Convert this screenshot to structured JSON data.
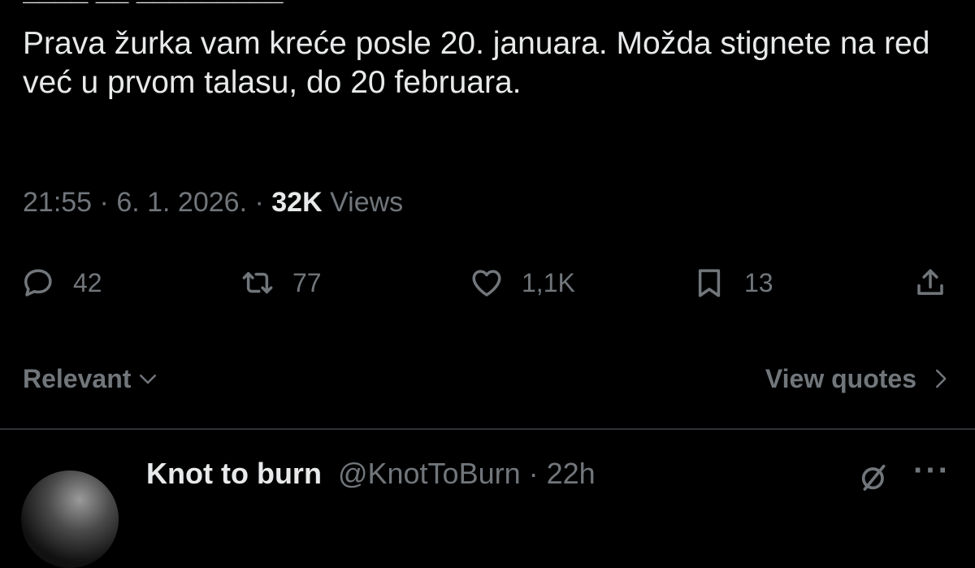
{
  "tweet": {
    "text": "Prava žurka vam kreće posle 20. januara. Možda stignete na red već u prvom talasu, do 20 februara.",
    "time": "21:55",
    "date": "6. 1. 2026.",
    "views_count": "32K",
    "views_label": "Views"
  },
  "actions": {
    "reply_count": "42",
    "retweet_count": "77",
    "like_count": "1,1K",
    "bookmark_count": "13"
  },
  "icons": {
    "reply": "reply-icon",
    "retweet": "retweet-icon",
    "like": "heart-icon",
    "bookmark": "bookmark-icon",
    "share": "share-icon",
    "grok": "grok-icon",
    "more": "more-icon"
  },
  "filters": {
    "sort_label": "Relevant",
    "view_quotes_label": "View quotes"
  },
  "reply": {
    "name": "Knot to burn",
    "handle": "@KnotToBurn",
    "time": "22h"
  },
  "colors": {
    "background": "#000000",
    "text": "#e7e9ea",
    "muted": "#71767b",
    "divider": "#2f3336"
  }
}
